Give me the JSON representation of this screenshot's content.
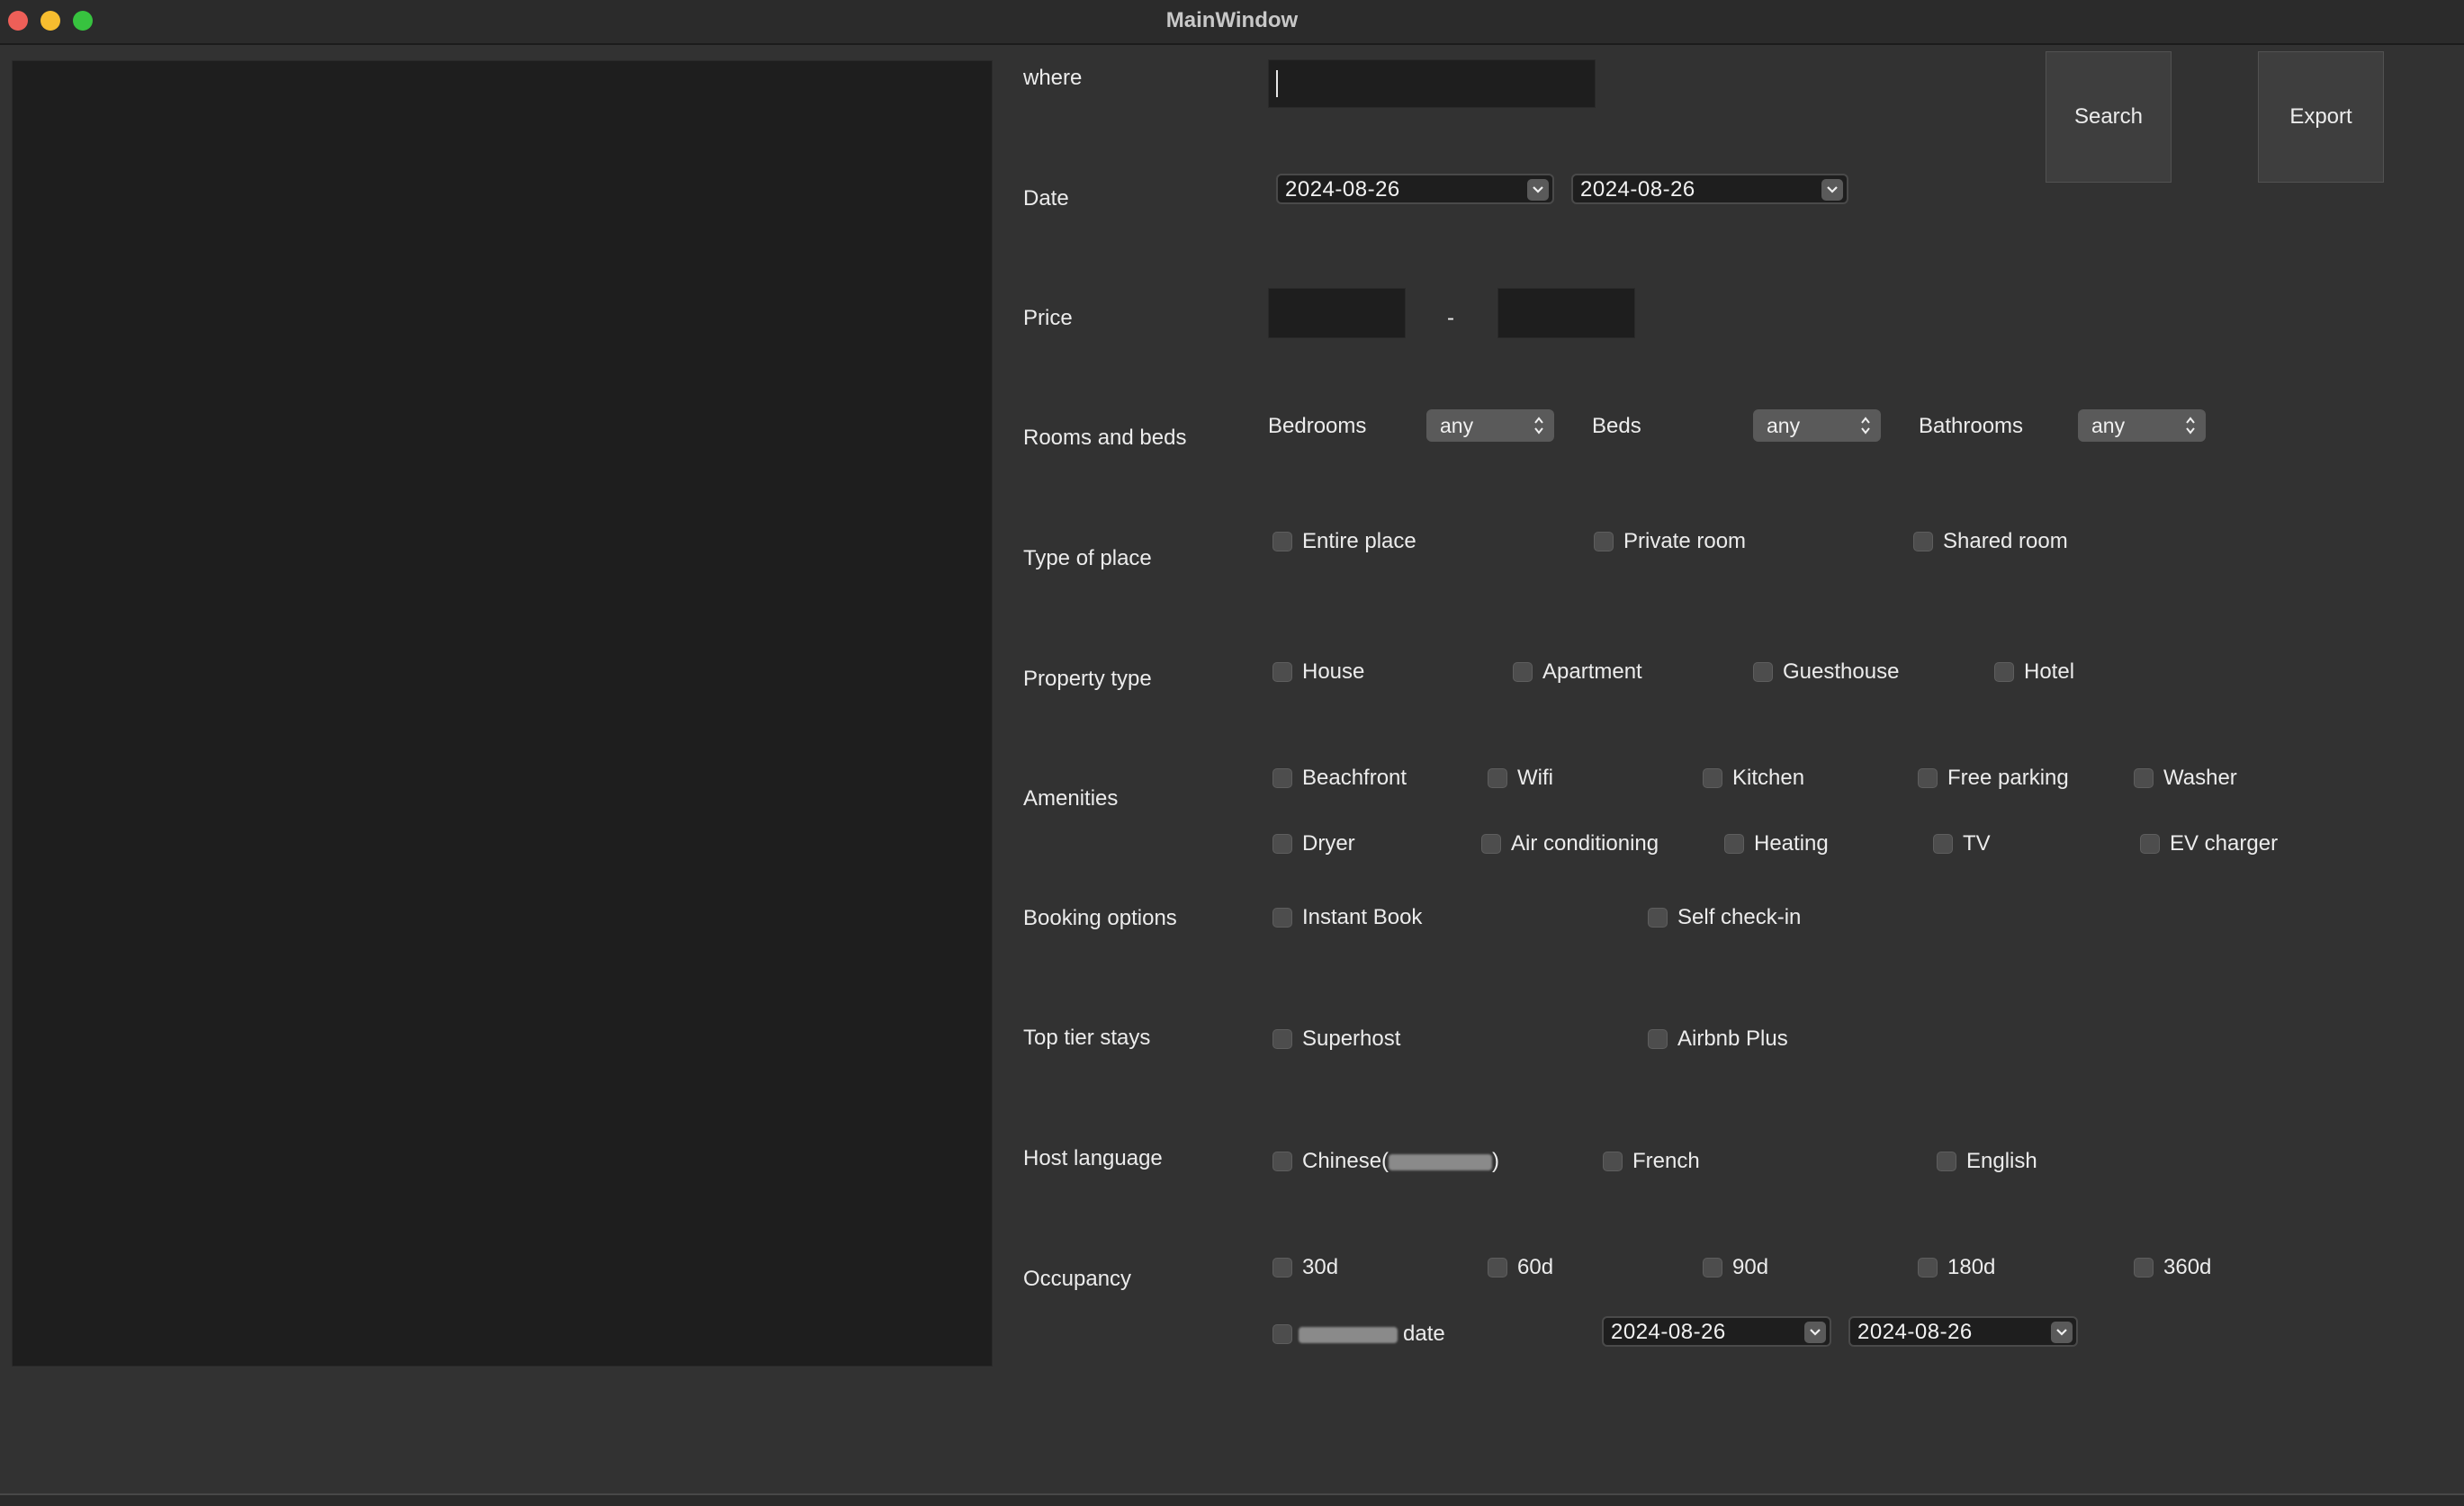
{
  "window": {
    "title": "MainWindow"
  },
  "buttons": {
    "search": "Search",
    "export": "Export"
  },
  "where": {
    "label": "where",
    "value": ""
  },
  "date": {
    "label": "Date",
    "from": "2024-08-26",
    "to": "2024-08-26"
  },
  "price": {
    "label": "Price",
    "min": "",
    "max": "",
    "separator": "-"
  },
  "rooms": {
    "label": "Rooms and beds",
    "bedrooms": {
      "label": "Bedrooms",
      "value": "any"
    },
    "beds": {
      "label": "Beds",
      "value": "any"
    },
    "bathrooms": {
      "label": "Bathrooms",
      "value": "any"
    }
  },
  "place_type": {
    "label": "Type of place",
    "options": [
      "Entire place",
      "Private room",
      "Shared room"
    ]
  },
  "property_type": {
    "label": "Property type",
    "options": [
      "House",
      "Apartment",
      "Guesthouse",
      "Hotel"
    ]
  },
  "amenities": {
    "label": "Amenities",
    "row1": [
      "Beachfront",
      "Wifi",
      "Kitchen",
      "Free parking",
      "Washer"
    ],
    "row2": [
      "Dryer",
      "Air conditioning",
      "Heating",
      "TV",
      "EV charger"
    ]
  },
  "booking": {
    "label": "Booking options",
    "options": [
      "Instant Book",
      "Self check-in"
    ]
  },
  "top_tier": {
    "label": "Top tier stays",
    "options": [
      "Superhost",
      "Airbnb Plus"
    ]
  },
  "host_language": {
    "label": "Host language",
    "chinese_prefix": "Chinese(",
    "chinese_suffix": ")",
    "options": [
      "French",
      "English"
    ]
  },
  "occupancy": {
    "label": "Occupancy",
    "options": [
      "30d",
      "60d",
      "90d",
      "180d",
      "360d"
    ],
    "custom_suffix": "date",
    "from": "2024-08-26",
    "to": "2024-08-26"
  },
  "colors": {
    "window_bg": "#323232",
    "panel_bg": "#1e1e1e",
    "text": "#ececec",
    "close": "#ee5f58",
    "minimize": "#f7bd2f",
    "maximize": "#37c33f"
  }
}
